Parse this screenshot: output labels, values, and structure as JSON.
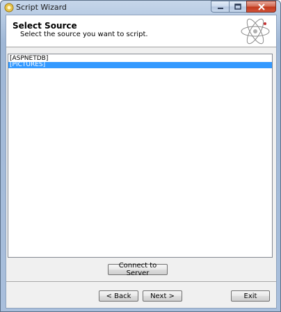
{
  "window": {
    "title": "Script Wizard"
  },
  "caption": {
    "minimize_icon": "minimize-icon",
    "maximize_icon": "maximize-icon",
    "close_icon": "close-icon"
  },
  "header": {
    "title": "Select Source",
    "subtitle": "Select the source you want to script.",
    "icon": "atom-icon"
  },
  "list": {
    "items": [
      {
        "label": "[ASPNETDB]",
        "selected": false
      },
      {
        "label": "[PICTURES]",
        "selected": true
      }
    ],
    "selection_color": "#3399ff"
  },
  "buttons": {
    "connect_label": "Connect to Server",
    "back_label": "< Back",
    "next_label": "Next >",
    "exit_label": "Exit"
  }
}
